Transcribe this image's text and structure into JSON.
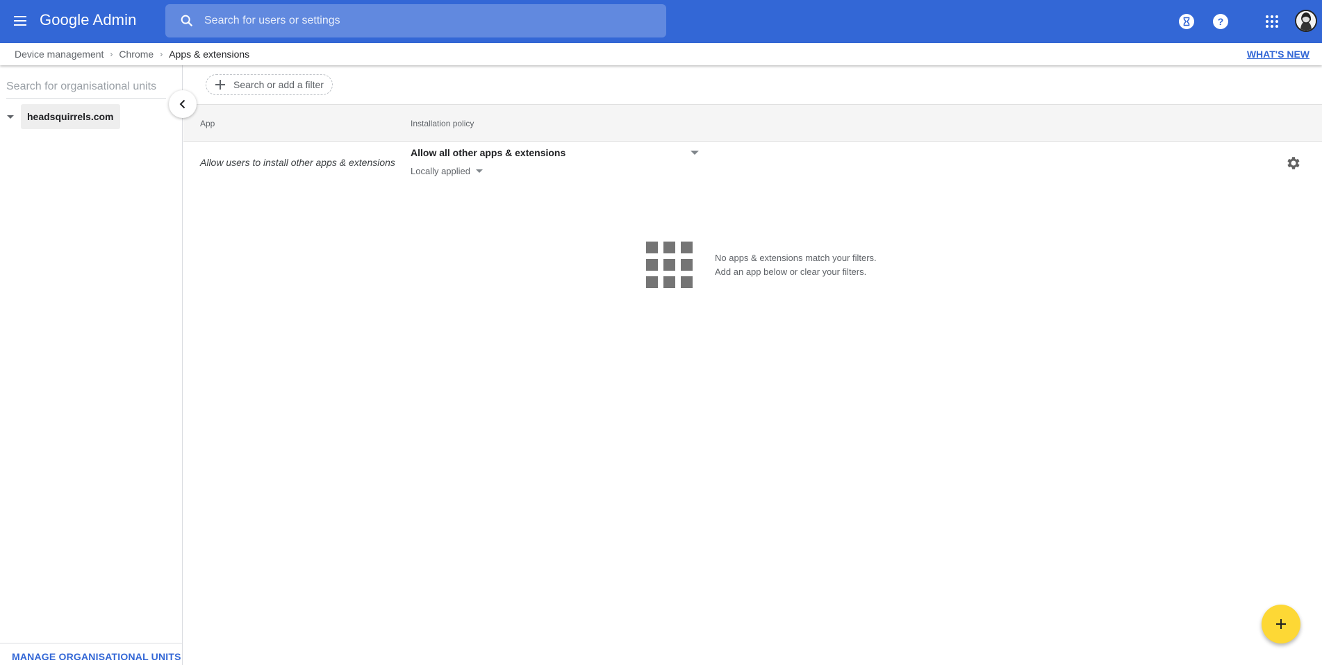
{
  "header": {
    "app_title": "Google Admin",
    "search_placeholder": "Search for users or settings",
    "icons": [
      "menu-icon",
      "search-icon",
      "hourglass-icon",
      "help-icon",
      "apps-grid-icon",
      "avatar"
    ]
  },
  "breadcrumb": {
    "items": [
      "Device management",
      "Chrome",
      "Apps & extensions"
    ],
    "whats_new": "WHAT'S NEW"
  },
  "left_panel": {
    "search_placeholder": "Search for organisational units",
    "org_unit": "headsquirrels.com",
    "manage_link": "MANAGE ORGANISATIONAL UNITS"
  },
  "main": {
    "filter_label": "Search or add a filter",
    "columns": [
      "App",
      "Installation policy"
    ],
    "rows": [
      {
        "app": "Allow users to install other apps & extensions",
        "policy": "Allow all other apps & extensions",
        "applied": "Locally applied"
      }
    ],
    "empty_state": {
      "line1": "No apps & extensions match your filters.",
      "line2": "Add an app below or clear your filters."
    }
  },
  "colors": {
    "header_bg": "#3367d6",
    "accent": "#3367d6",
    "fab": "#fdd835"
  }
}
